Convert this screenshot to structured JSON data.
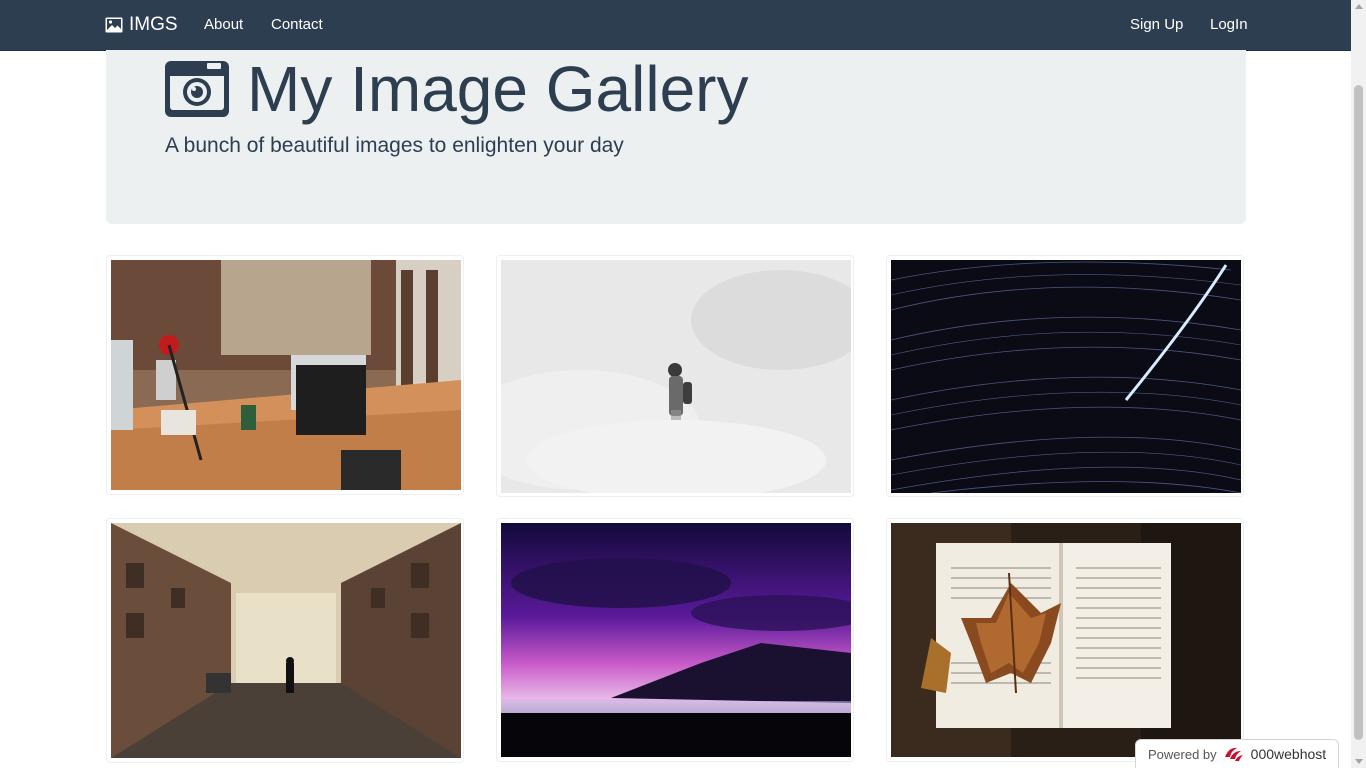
{
  "navbar": {
    "brand": "IMGS",
    "links": [
      {
        "label": "About"
      },
      {
        "label": "Contact"
      }
    ],
    "right_links": [
      {
        "label": "Sign Up"
      },
      {
        "label": "LogIn"
      }
    ]
  },
  "hero": {
    "title": "My Image Gallery",
    "subtitle": "A bunch of beautiful images to enlighten your day"
  },
  "gallery": {
    "images": [
      {
        "subject": "office-desk"
      },
      {
        "subject": "man-in-fog"
      },
      {
        "subject": "star-trails"
      },
      {
        "subject": "foggy-street"
      },
      {
        "subject": "purple-sky-coast"
      },
      {
        "subject": "book-with-leaf"
      }
    ]
  },
  "badge": {
    "prefix": "Powered by",
    "brand": "000webhost"
  },
  "colors": {
    "navbar": "#2c3e50",
    "hero_bg": "#ecf0f1",
    "text": "#2c3e50"
  }
}
